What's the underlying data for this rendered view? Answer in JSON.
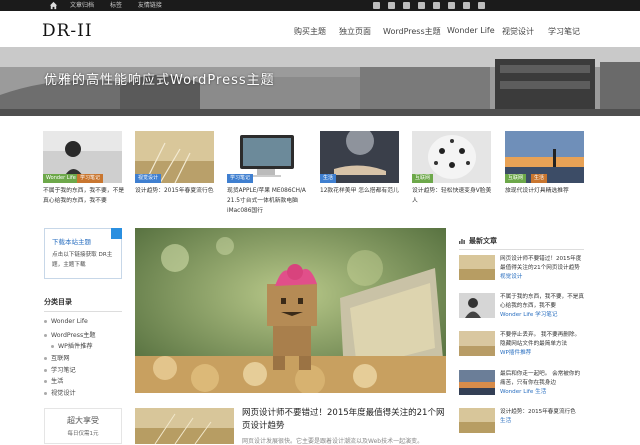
{
  "topbar": {
    "links": [
      "文章归档",
      "标签",
      "友情链接"
    ],
    "social_icons": [
      "twitter-icon",
      "weibo-icon",
      "qq-icon",
      "rss-icon",
      "tablet-icon",
      "wordpress-icon",
      "image-icon",
      "instagram-icon"
    ]
  },
  "header": {
    "logo": "DR-II",
    "nav": [
      "购买主题",
      "独立页面",
      "WordPress主题",
      "Wonder Life",
      "视觉设计",
      "学习笔记"
    ]
  },
  "hero": {
    "title": "优雅的高性能响应式WordPress主题"
  },
  "thumbs": [
    {
      "tag": "Wonder Life",
      "tag2": "学习笔记",
      "caption": "不属于我的东西，我不要，不是真心给我的东西，我不要"
    },
    {
      "tag": "视觉设计",
      "caption": "设计趋势：2015年春夏流行色"
    },
    {
      "tag": "学习笔记",
      "caption": "现货APPLE/苹果 ME086CH/A 21.5寸台式一体机新款电脑iMac086国行"
    },
    {
      "tag": "生活",
      "caption": "12款花样美甲 怎么搭都有范儿"
    },
    {
      "tag": "互联网",
      "caption": "设计趋势：轻松快速变身V脸美人"
    },
    {
      "tag": "互联网",
      "tag2": "生活",
      "caption": "旅现代设计灯具精选推荐"
    }
  ],
  "sidebar_left": {
    "download_title": "下载本站主题",
    "download_text": "点击以下链接获取 DR主题，主题下载",
    "categories_title": "分类目录",
    "categories": [
      "Wonder Life",
      "WordPress主题",
      "WP插件推荐",
      "互联网",
      "学习笔记",
      "生活",
      "视觉设计"
    ],
    "promo_title": "超大享受",
    "promo_sub": "每日仅需1元"
  },
  "main_post": {
    "title": "网页设计师不要错过！2015年度最值得关注的21个网页设计趋势",
    "excerpt": "网页设计发展很快。它主要是跟着设计潮流以及Web技术一起演变。"
  },
  "sidebar_right": {
    "title": "最新文章",
    "items": [
      {
        "title": "网页设计师不要错过！2015年度最值得关注的21个网页设计趋势",
        "cat": "视觉设计"
      },
      {
        "title": "不属于我的东西，我不要，不是真心给我的东西，我不要",
        "cat": "Wonder Life   学习笔记"
      },
      {
        "title": "不要停止丢弃。 我不要再删除。 隐藏网站文件的最简单方法",
        "cat": "WP插件推荐"
      },
      {
        "title": "最后和你走一起吧。 会常被你的痛苦，只有你在我身边",
        "cat": "Wonder Life   生活"
      },
      {
        "title": "设计趋势：2015年春夏流行色",
        "cat": "生活"
      }
    ]
  },
  "colors": {
    "accent": "#2a6fc0",
    "topbar": "#1b1b1b"
  }
}
